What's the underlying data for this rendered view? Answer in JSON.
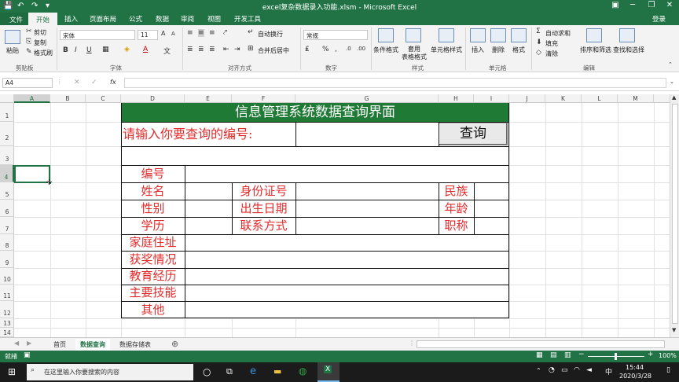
{
  "window": {
    "title": "excel复杂数据录入功能.xlsm - Microsoft Excel",
    "login": "登录"
  },
  "tabs": [
    "文件",
    "开始",
    "插入",
    "页面布局",
    "公式",
    "数据",
    "审阅",
    "视图",
    "开发工具"
  ],
  "ribbon": {
    "clipboard": {
      "paste": "粘贴",
      "cut": "剪切",
      "copy": "复制",
      "format_painter": "格式刷",
      "label": "剪贴板"
    },
    "font": {
      "name": "宋体",
      "size": "11",
      "label": "字体",
      "bold": "B",
      "italic": "I",
      "underline": "U"
    },
    "alignment": {
      "wrap": "自动换行",
      "merge": "合并后居中",
      "label": "对齐方式"
    },
    "number": {
      "format": "常规",
      "label": "数字"
    },
    "styles": {
      "conditional": "条件格式",
      "table": "套用\n表格格式",
      "cell": "单元格样式",
      "label": "样式"
    },
    "cells": {
      "insert": "插入",
      "delete": "删除",
      "format": "格式",
      "label": "单元格"
    },
    "editing": {
      "autosum": "自动求和",
      "fill": "填充",
      "clear": "清除",
      "sort": "排序和筛选",
      "find": "查找和选择",
      "label": "编辑"
    }
  },
  "formula_bar": {
    "name_box": "A4",
    "fx": "fx",
    "value": ""
  },
  "columns": [
    "A",
    "B",
    "C",
    "D",
    "E",
    "F",
    "G",
    "H",
    "I",
    "J",
    "K",
    "L",
    "M"
  ],
  "rows": [
    "1",
    "2",
    "3",
    "4",
    "5",
    "6",
    "7",
    "8",
    "9",
    "10",
    "11",
    "12",
    "13",
    "14"
  ],
  "sheet": {
    "title": "信息管理系统数据查询界面",
    "prompt": "请输入你要查询的编号:",
    "query_button": "查询",
    "fields": {
      "id": "编号",
      "name": "姓名",
      "gender": "性别",
      "education": "学历",
      "id_card": "身份证号",
      "birth": "出生日期",
      "contact": "联系方式",
      "ethnic": "民族",
      "age": "年龄",
      "title": "职称",
      "address": "家庭住址",
      "awards": "获奖情况",
      "edu_history": "教育经历",
      "skills": "主要技能",
      "other": "其他"
    },
    "header_color": "#1e7a34",
    "label_color": "#e32b2b"
  },
  "sheet_tabs": [
    "首页",
    "数据查询",
    "数据存储表"
  ],
  "active_sheet": "数据查询",
  "status": {
    "ready": "就绪",
    "zoom": "100%"
  },
  "taskbar": {
    "search": "在这里输入你要搜索的内容",
    "time": "15:44",
    "date": "2020/3/28",
    "ime": "中"
  }
}
